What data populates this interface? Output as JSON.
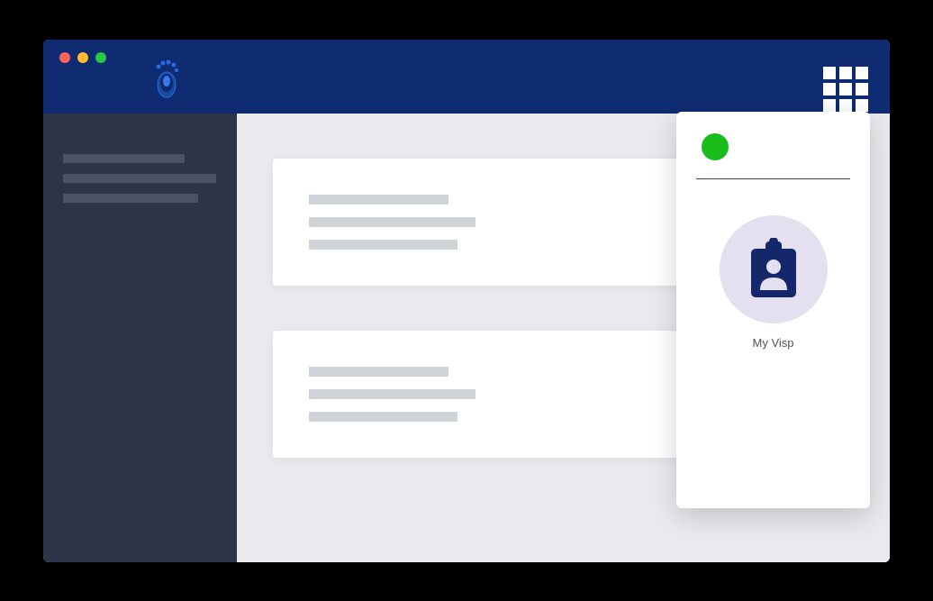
{
  "window": {
    "controls": {
      "close": "close",
      "minimize": "minimize",
      "maximize": "maximize"
    }
  },
  "header": {
    "logo_name": "footprint-logo",
    "apps_button_name": "apps-grid"
  },
  "popover": {
    "status": "online",
    "app": {
      "label": "My Visp",
      "icon": "assignment-person-icon"
    }
  },
  "colors": {
    "header_bg": "#0f2c73",
    "sidebar_bg": "#2c3548",
    "body_bg": "#e8eaed",
    "status_online": "#1abc1a",
    "icon_accent": "#15276b",
    "icon_circle_bg": "#e4e0f0"
  }
}
